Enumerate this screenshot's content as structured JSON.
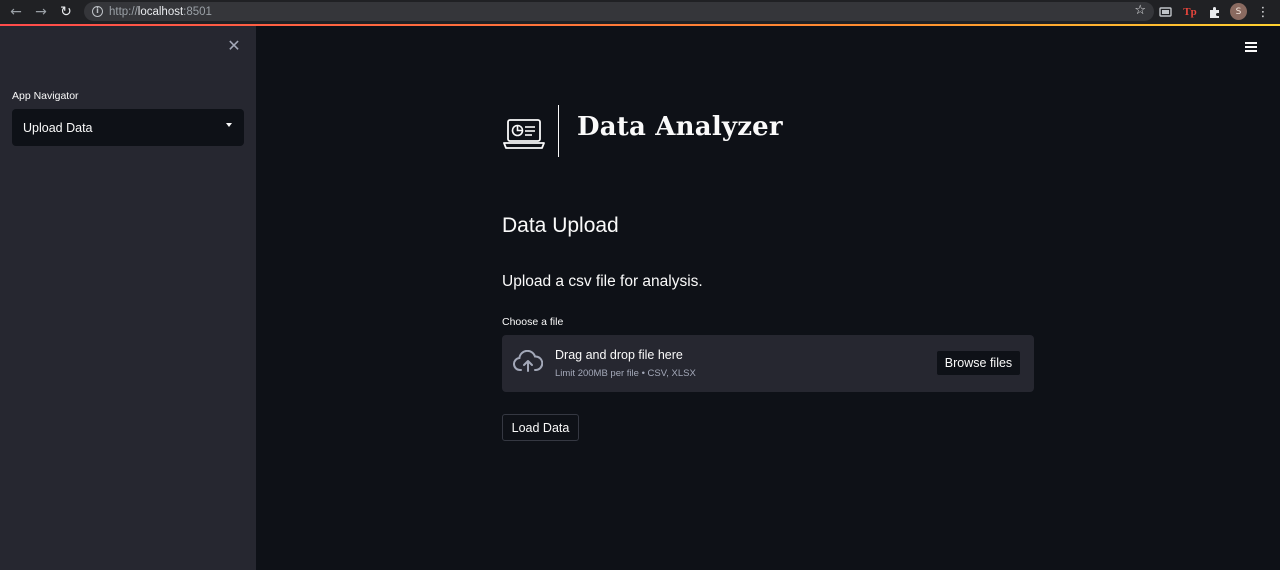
{
  "browser": {
    "url_prefix": "http://",
    "url_host": "localhost",
    "url_port": ":8501",
    "back_icon": "←",
    "forward_icon": "→",
    "reload_icon": "↻",
    "avatar_letter": "S",
    "tp_label": "Tp"
  },
  "sidebar": {
    "nav_label": "App Navigator",
    "select_value": "Upload Data"
  },
  "main": {
    "app_title": "Data Analyzer",
    "heading": "Data Upload",
    "subtitle": "Upload a csv file for analysis.",
    "file_label": "Choose a file",
    "dropzone_title": "Drag and drop file here",
    "dropzone_sub": "Limit 200MB per file • CSV, XLSX",
    "browse_label": "Browse files",
    "load_label": "Load Data"
  },
  "colors": {
    "background": "#0e1117",
    "sidebar": "#262730",
    "text": "#fafafa",
    "muted": "#a3a8b8",
    "accent": "#ff4b4b"
  }
}
